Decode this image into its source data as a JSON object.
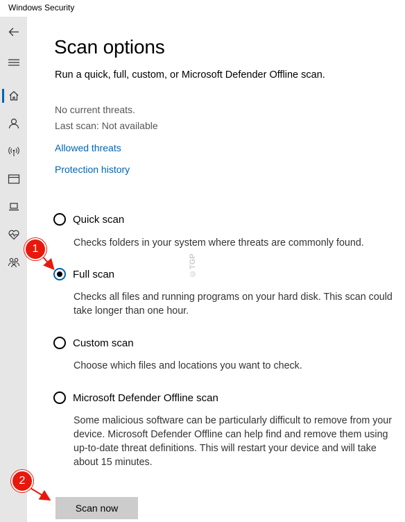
{
  "window": {
    "title": "Windows Security"
  },
  "sidebar": {
    "items": [
      {
        "icon": "back-arrow-icon"
      },
      {
        "icon": "hamburger-menu-icon"
      },
      {
        "icon": "home-icon",
        "active": true
      },
      {
        "icon": "person-icon"
      },
      {
        "icon": "wireless-antenna-icon"
      },
      {
        "icon": "browser-window-icon"
      },
      {
        "icon": "laptop-icon"
      },
      {
        "icon": "heart-pulse-icon"
      },
      {
        "icon": "family-icon"
      }
    ]
  },
  "page": {
    "title": "Scan options",
    "subtitle": "Run a quick, full, custom, or Microsoft Defender Offline scan.",
    "status_threats": "No current threats.",
    "status_last_scan": "Last scan: Not available",
    "link_allowed_threats": "Allowed threats",
    "link_protection_history": "Protection history"
  },
  "scan_options": [
    {
      "label": "Quick scan",
      "description": "Checks folders in your system where threats are commonly found.",
      "selected": false
    },
    {
      "label": "Full scan",
      "description": "Checks all files and running programs on your hard disk. This scan could take longer than one hour.",
      "selected": true
    },
    {
      "label": "Custom scan",
      "description": "Choose which files and locations you want to check.",
      "selected": false
    },
    {
      "label": "Microsoft Defender Offline scan",
      "description": "Some malicious software can be particularly difficult to remove from your device. Microsoft Defender Offline can help find and remove them using up-to-date threat definitions. This will restart your device and will take about 15 minutes.",
      "selected": false
    }
  ],
  "scan_button_label": "Scan now",
  "annotations": {
    "step1": "1",
    "step2": "2"
  },
  "watermark": "©TGP",
  "colors": {
    "accent": "#0063b1",
    "annotation": "#e8180c",
    "sidebar_bg": "#e6e6e6",
    "button_bg": "#cccccc"
  }
}
